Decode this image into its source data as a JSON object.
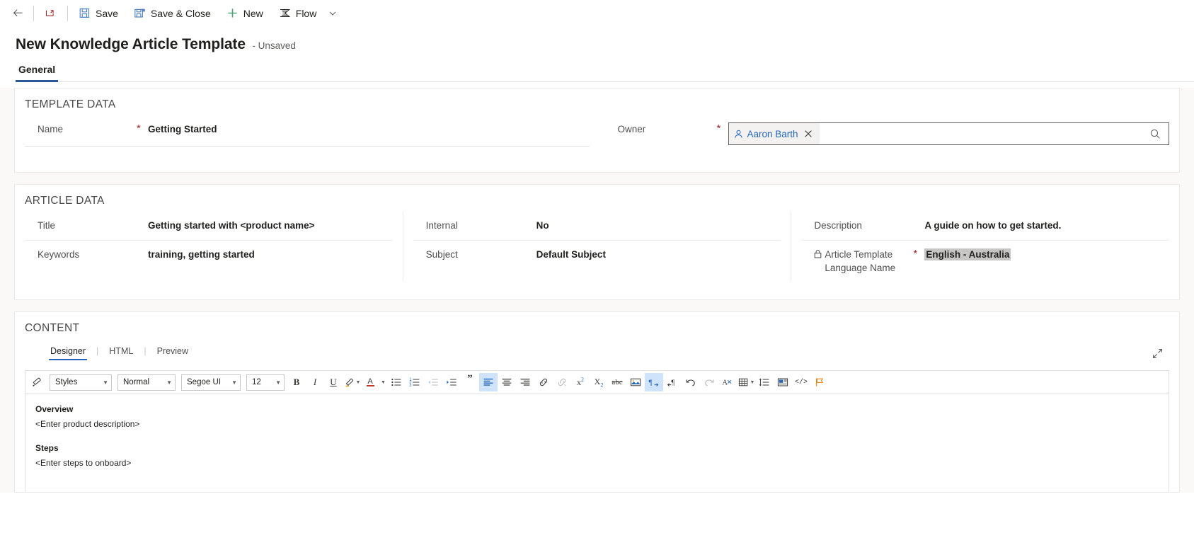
{
  "commandbar": {
    "back_label": "",
    "back_icon": "arrow-left-icon",
    "popout_icon": "open-in-new-window-icon",
    "items": [
      {
        "label": "Save",
        "icon": "save-icon"
      },
      {
        "label": "Save & Close",
        "icon": "save-and-close-icon"
      },
      {
        "label": "New",
        "icon": "plus-icon"
      },
      {
        "label": "Flow",
        "icon": "flow-icon"
      }
    ],
    "overflow_icon": "chevron-down-icon"
  },
  "record": {
    "title": "New Knowledge Article Template",
    "state": "- Unsaved"
  },
  "tabs": [
    {
      "label": "General",
      "active": true
    }
  ],
  "sections": {
    "template_data": {
      "heading": "TEMPLATE DATA",
      "left": [
        {
          "label": "Name",
          "required": true,
          "value": "Getting Started"
        }
      ],
      "right": [
        {
          "label": "Owner",
          "required": true,
          "lookup": {
            "pill_icon": "person-icon",
            "pill_label": "Aaron Barth",
            "remove_icon": "close-icon",
            "search_icon": "search-icon"
          }
        }
      ]
    },
    "article_data": {
      "heading": "ARTICLE DATA",
      "col1": [
        {
          "label": "Title",
          "required": false,
          "value": "Getting started with <product name>"
        },
        {
          "label": "Keywords",
          "required": false,
          "value": "training, getting started"
        }
      ],
      "col2": [
        {
          "label": "Internal",
          "required": false,
          "value": "No"
        },
        {
          "label": "Subject",
          "required": false,
          "value": "Default Subject"
        }
      ],
      "col3": [
        {
          "label": "Description",
          "required": false,
          "value": "A guide on how to get started."
        },
        {
          "label": "Article Template Language Name",
          "required": true,
          "value": "English - Australia",
          "locked": true,
          "lock_icon": "lock-icon",
          "selected": true
        }
      ]
    },
    "content": {
      "heading": "CONTENT",
      "editor_tabs": [
        {
          "label": "Designer",
          "active": true
        },
        {
          "label": "HTML",
          "active": false
        },
        {
          "label": "Preview",
          "active": false
        }
      ],
      "tab_separator": "|",
      "expand_icon": "expand-diagonal-icon",
      "toolbar": {
        "format_painter_icon": "format-painter-icon",
        "styles": {
          "value": "Styles",
          "caret_icon": "chevron-down-icon"
        },
        "paragraph_format": {
          "value": "Normal",
          "caret_icon": "chevron-down-icon"
        },
        "font_family": {
          "value": "Segoe UI",
          "caret_icon": "chevron-down-icon"
        },
        "font_size": {
          "value": "12",
          "caret_icon": "chevron-down-icon"
        },
        "buttons": [
          {
            "icon": "bold-icon",
            "glyph": "B",
            "state": "normal"
          },
          {
            "icon": "italic-icon",
            "glyph": "I",
            "state": "normal"
          },
          {
            "icon": "underline-icon",
            "glyph": "U",
            "state": "normal"
          },
          {
            "icon": "highlight-color-icon",
            "state": "normal"
          },
          {
            "icon": "font-color-icon",
            "glyph": "A",
            "state": "normal"
          },
          {
            "icon": "bulleted-list-icon",
            "state": "normal"
          },
          {
            "icon": "numbered-list-icon",
            "state": "normal"
          },
          {
            "icon": "decrease-indent-icon",
            "state": "disabled"
          },
          {
            "icon": "increase-indent-icon",
            "state": "normal"
          },
          {
            "icon": "block-quote-icon",
            "state": "normal"
          },
          {
            "icon": "align-left-icon",
            "state": "active"
          },
          {
            "icon": "align-center-icon",
            "state": "normal"
          },
          {
            "icon": "align-right-icon",
            "state": "normal"
          },
          {
            "icon": "insert-link-icon",
            "state": "normal"
          },
          {
            "icon": "remove-link-icon",
            "state": "disabled"
          },
          {
            "icon": "superscript-icon",
            "state": "normal"
          },
          {
            "icon": "subscript-icon",
            "state": "normal"
          },
          {
            "icon": "strikethrough-icon",
            "state": "normal"
          },
          {
            "icon": "insert-image-icon",
            "state": "normal"
          },
          {
            "icon": "left-to-right-icon",
            "state": "active"
          },
          {
            "icon": "right-to-left-icon",
            "state": "normal"
          },
          {
            "icon": "undo-icon",
            "state": "normal"
          },
          {
            "icon": "redo-icon",
            "state": "disabled"
          },
          {
            "icon": "clear-formatting-icon",
            "state": "normal"
          },
          {
            "icon": "table-icon",
            "state": "normal"
          },
          {
            "icon": "line-spacing-icon",
            "state": "normal"
          },
          {
            "icon": "image-with-text-icon",
            "state": "normal"
          },
          {
            "icon": "source-code-icon",
            "glyph": "</>",
            "state": "normal"
          },
          {
            "icon": "flag-icon",
            "state": "normal"
          }
        ]
      },
      "body": [
        {
          "text": "Overview",
          "style": "heading"
        },
        {
          "text": "<Enter product description>",
          "style": "normal"
        },
        {
          "text": "",
          "style": "spacer"
        },
        {
          "text": "Steps",
          "style": "heading"
        },
        {
          "text": "<Enter steps to onboard>",
          "style": "normal"
        }
      ]
    }
  },
  "colors": {
    "accent": "#2b579a",
    "link": "#2266bb",
    "required": "#a4262c",
    "save_icon": "#4a7dbd",
    "new_icon": "#52a37a",
    "toolbar_active": "#cfe4fa",
    "selection": "#c8c6c4",
    "flag": "#e8871a"
  }
}
